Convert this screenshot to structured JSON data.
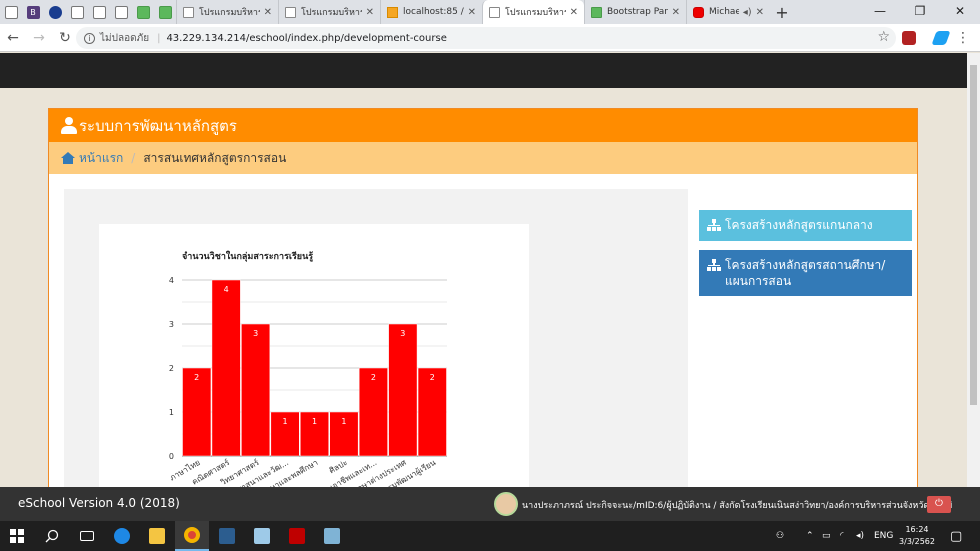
{
  "browser": {
    "tabs": [
      {
        "title": "โปรแกรมบริหาร",
        "icon": "doc-icon",
        "active": false
      },
      {
        "title": "โปรแกรมบริหาร",
        "icon": "doc-icon",
        "active": false
      },
      {
        "title": "localhost:85 /",
        "icon": "warning-icon",
        "active": false
      },
      {
        "title": "โปรแกรมบริหาร",
        "icon": "doc-icon",
        "active": true
      },
      {
        "title": "Bootstrap Pan",
        "icon": "bootstrap-icon",
        "active": false
      },
      {
        "title": "Michael",
        "icon": "youtube-icon",
        "active": false
      }
    ],
    "security_label": "ไม่ปลอดภัย",
    "url": "43.229.134.214/eschool/index.php/development-course"
  },
  "panel": {
    "title": "ระบบการพัฒนาหลักสูตร",
    "breadcrumb_home": "หน้าแรก",
    "breadcrumb_current": "สารสนเทศหลักสูตรการสอน"
  },
  "side_buttons": {
    "core_curriculum": "โครงสร้างหลักสูตรแกนกลาง",
    "school_curriculum": "โครงสร้างหลักสูตรสถานศึกษา/แผนการสอน"
  },
  "chart_data": {
    "type": "bar",
    "title": "จำนวนวิชาในกลุ่มสาระการเรียนรู้",
    "categories": [
      "ภาษาไทย",
      "คณิตศาสตร์",
      "วิทยาศาสตร์",
      "สังคมศึกษาฯ",
      "สุขศึกษาและพลศึกษา",
      "ศิลปะ",
      "การงานอาชีพฯ",
      "ภาษาต่างประเทศ",
      "กิจกรรมพัฒนาผู้เรียน"
    ],
    "category_labels_visible": [
      "ภาษาไทย",
      "คณิตศาสตร์",
      "วิทยาศาสตร์",
      "งคมศึกษ ศาสนาและวัฒ...",
      "ศึกษาและพลศึกษา",
      "ศิลปะ",
      "การงานอาชีพและเท...",
      "ภาษาต่างประเทศ",
      "กรรมพัฒนาผู้เรียน"
    ],
    "values": [
      2,
      4,
      3,
      1,
      1,
      1,
      2,
      3,
      2
    ],
    "ylim": [
      0,
      4
    ],
    "yticks": [
      0,
      1,
      2,
      3,
      4
    ],
    "bar_color": "#ff0000",
    "grid": true
  },
  "footer": {
    "version": "eSchool Version 4.0 (2018)",
    "user": "นางประภาภรณ์ ประกิจจะนะ/mID:6/ผู้ปฏิบัติงาน / สังกัดโรงเรียนเนินสง่าวิทยา/องค์การบริหารส่วนจังหวัดชัยภูมิ"
  },
  "taskbar": {
    "language": "ENG",
    "time": "16:24",
    "date": "3/3/2562"
  }
}
